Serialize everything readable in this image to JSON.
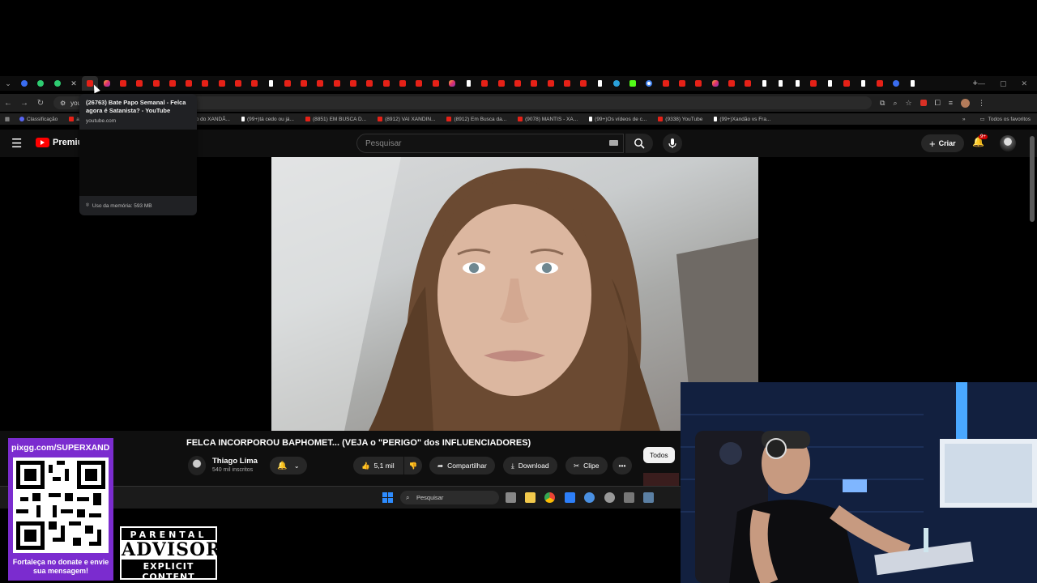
{
  "browser": {
    "tab_favicons": [
      "blue",
      "green",
      "green",
      "close",
      "yt",
      "ig",
      "yt",
      "yt",
      "yt",
      "yt",
      "yt",
      "yt",
      "yt",
      "yt",
      "yt",
      "tt",
      "yt",
      "yt",
      "yt",
      "yt",
      "yt",
      "yt",
      "yt",
      "yt",
      "yt",
      "yt",
      "ig",
      "tt",
      "yt",
      "yt",
      "yt",
      "yt",
      "yt",
      "yt",
      "yt",
      "tt",
      "tg",
      "k",
      "g",
      "yt",
      "yt",
      "yt",
      "ig",
      "yt",
      "yt",
      "tt",
      "tt",
      "tt",
      "yt",
      "tt",
      "yt",
      "tt",
      "yt",
      "blue",
      "tt"
    ],
    "new_tab": "+",
    "url_prefix": "you",
    "bookmarks": [
      {
        "label": "Classificação",
        "icon": "discord-icon"
      },
      {
        "label": "al |...",
        "icon": "yt"
      },
      {
        "label": "(8159) SUPER XAND...",
        "icon": "yt"
      },
      {
        "label": "(99+)rap do XANDÃ...",
        "icon": "tt"
      },
      {
        "label": "(99+)tá cedo ou já...",
        "icon": "tt"
      },
      {
        "label": "(8851) EM BUSCA D...",
        "icon": "yt"
      },
      {
        "label": "(8912) VAI XANDIN...",
        "icon": "yt"
      },
      {
        "label": "(8912) Em Busca da...",
        "icon": "yt"
      },
      {
        "label": "(9078) MANTIS - XA...",
        "icon": "yt"
      },
      {
        "label": "(99+)Os vídeos de c...",
        "icon": "tt"
      },
      {
        "label": "(9338) YouTube",
        "icon": "yt"
      },
      {
        "label": "(99+)Xandão vs Fra...",
        "icon": "tt"
      }
    ],
    "all_bookmarks": "Todos os favoritos"
  },
  "tooltip": {
    "title": "(26763) Bate Papo Semanal - Felca agora é Satanista? - YouTube",
    "host": "youtube.com",
    "memory": "Uso da memória: 593 MB"
  },
  "youtube": {
    "logo_text": "Premiu",
    "search_placeholder": "Pesquisar",
    "create_label": "Criar",
    "notif_badge": "9+"
  },
  "video": {
    "title": "FELCA INCORPOROU BAPHOMET... (VEJA o \"PERIGO\" dos INFLUENCIADORES)",
    "channel": "Thiago Lima",
    "subscribers": "540 mil inscritos",
    "likes": "5,1 mil",
    "share_label": "Compartilhar",
    "download_label": "Download",
    "clip_label": "Clipe",
    "chip_all": "Todos"
  },
  "taskbar": {
    "search_label": "Pesquisar"
  },
  "overlay": {
    "pix_url": "pixgg.com/SUPERXAND",
    "donate_caption": "Fortaleça no donate e envie sua mensagem!",
    "advisory_top": "PARENTAL",
    "advisory_mid": "ADVISORY",
    "advisory_bot": "EXPLICIT CONTENT"
  }
}
